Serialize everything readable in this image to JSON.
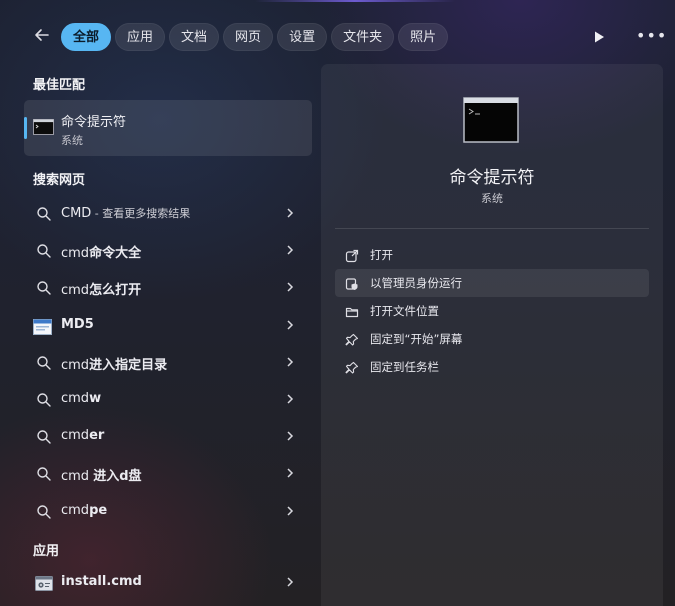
{
  "header": {
    "tabs": [
      {
        "label": "全部",
        "active": true
      },
      {
        "label": "应用"
      },
      {
        "label": "文档"
      },
      {
        "label": "网页"
      },
      {
        "label": "设置"
      },
      {
        "label": "文件夹"
      },
      {
        "label": "照片"
      }
    ]
  },
  "sections": {
    "best_match": "最佳匹配",
    "search_web": "搜索网页",
    "apps": "应用"
  },
  "best_match": {
    "name": "命令提示符",
    "sub": "系统"
  },
  "web_results": [
    {
      "prefix": "CMD",
      "rest": "",
      "hint": " - 查看更多搜索结果",
      "icon": "search-icon"
    },
    {
      "prefix": "cmd",
      "rest": "命令大全",
      "hint": "",
      "icon": "search-icon"
    },
    {
      "prefix": "cmd",
      "rest": "怎么打开",
      "hint": "",
      "icon": "search-icon"
    },
    {
      "prefix": "",
      "rest": "MD5",
      "hint": "",
      "icon": "md5-site-icon"
    },
    {
      "prefix": "cmd",
      "rest": "进入指定目录",
      "hint": "",
      "icon": "search-icon"
    },
    {
      "prefix": "cmd",
      "rest": "w",
      "hint": "",
      "icon": "search-icon"
    },
    {
      "prefix": "cmd",
      "rest": "er",
      "hint": "",
      "icon": "search-icon"
    },
    {
      "prefix": "cmd ",
      "rest": "进入d盘",
      "hint": "",
      "icon": "search-icon"
    },
    {
      "prefix": "cmd",
      "rest": "pe",
      "hint": "",
      "icon": "search-icon"
    }
  ],
  "app_result": {
    "label": "install.cmd",
    "icon": "script-file-icon"
  },
  "detail": {
    "title": "命令提示符",
    "sub": "系统",
    "actions": [
      {
        "label": "打开",
        "icon": "open-external-icon"
      },
      {
        "label": "以管理员身份运行",
        "icon": "shield-admin-icon"
      },
      {
        "label": "打开文件位置",
        "icon": "folder-icon"
      },
      {
        "label": "固定到“开始”屏幕",
        "icon": "pin-icon"
      },
      {
        "label": "固定到任务栏",
        "icon": "pin-icon"
      }
    ]
  },
  "colors": {
    "accent": "#57b6f2"
  }
}
